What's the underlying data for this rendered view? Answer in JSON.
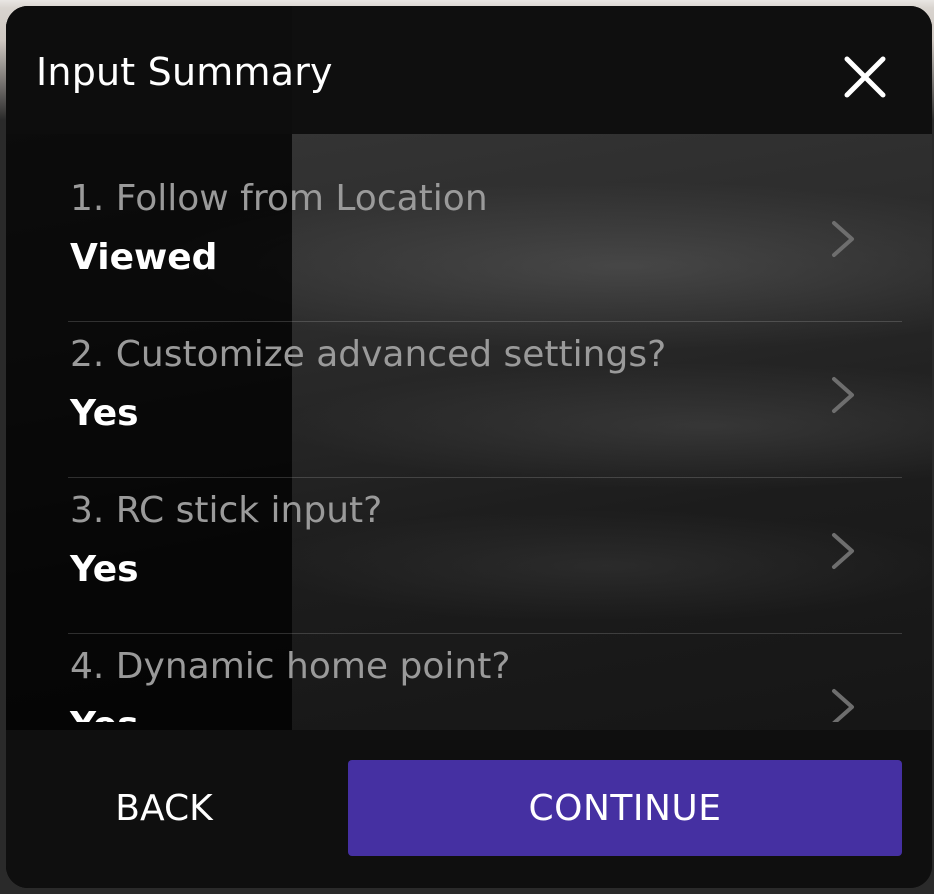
{
  "dialog": {
    "title": "Input Summary",
    "close_icon": "close-icon"
  },
  "items": [
    {
      "question": "1. Follow from Location",
      "answer": "Viewed",
      "icon": "chevron-right-icon"
    },
    {
      "question": "2. Customize advanced settings?",
      "answer": "Yes",
      "icon": "chevron-right-icon"
    },
    {
      "question": "3. RC stick input?",
      "answer": "Yes",
      "icon": "chevron-right-icon"
    },
    {
      "question": "4. Dynamic home point?",
      "answer": "Yes",
      "icon": "chevron-right-icon"
    }
  ],
  "footer": {
    "back_label": "BACK",
    "continue_label": "CONTINUE"
  },
  "colors": {
    "accent": "#4530a2",
    "panel": "#111111",
    "question_text": "#9a9a9a",
    "answer_text": "#ffffff"
  }
}
